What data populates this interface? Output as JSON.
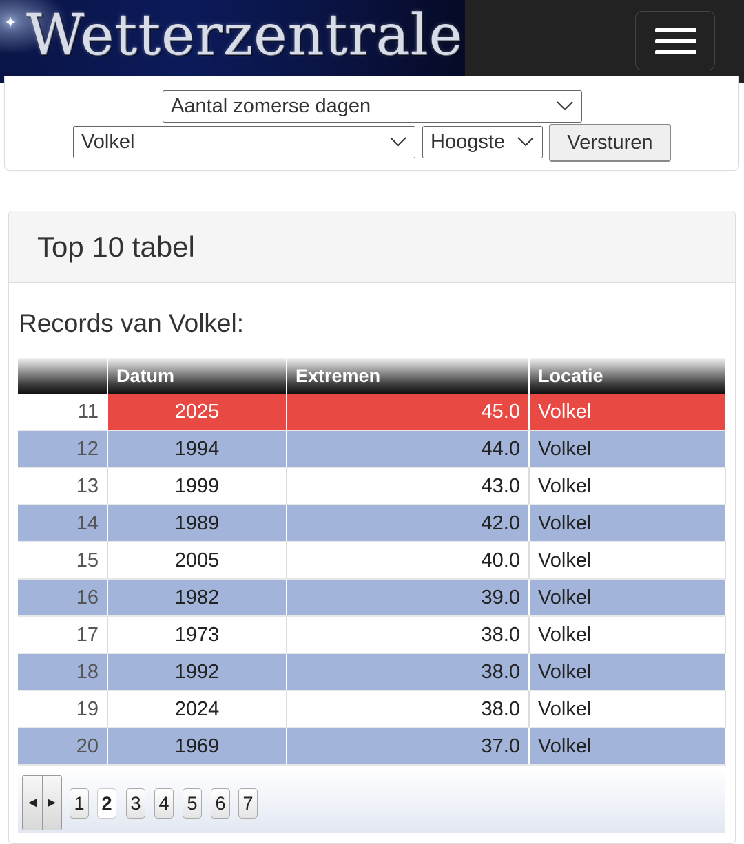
{
  "header": {
    "logo_text": "Wetterzentrale",
    "menu_icon": "hamburger-menu-icon"
  },
  "form": {
    "statistic_select": "Aantal zomerse dagen",
    "station_select": "Volkel",
    "order_select": "Hoogste",
    "submit_label": "Versturen"
  },
  "card": {
    "title": "Top 10 tabel",
    "records_title": "Records van Volkel:"
  },
  "table": {
    "columns": [
      "",
      "Datum",
      "Extremen",
      "Locatie"
    ],
    "rows": [
      {
        "rank": "11",
        "date": "2025",
        "value": "45.0",
        "location": "Volkel"
      },
      {
        "rank": "12",
        "date": "1994",
        "value": "44.0",
        "location": "Volkel"
      },
      {
        "rank": "13",
        "date": "1999",
        "value": "43.0",
        "location": "Volkel"
      },
      {
        "rank": "14",
        "date": "1989",
        "value": "42.0",
        "location": "Volkel"
      },
      {
        "rank": "15",
        "date": "2005",
        "value": "40.0",
        "location": "Volkel"
      },
      {
        "rank": "16",
        "date": "1982",
        "value": "39.0",
        "location": "Volkel"
      },
      {
        "rank": "17",
        "date": "1973",
        "value": "38.0",
        "location": "Volkel"
      },
      {
        "rank": "18",
        "date": "1992",
        "value": "38.0",
        "location": "Volkel"
      },
      {
        "rank": "19",
        "date": "2024",
        "value": "38.0",
        "location": "Volkel"
      },
      {
        "rank": "20",
        "date": "1969",
        "value": "37.0",
        "location": "Volkel"
      }
    ],
    "highlight_color": "#e84a43",
    "alt_row_color": "#a2b4d9"
  },
  "pager": {
    "prev_symbol": "◄",
    "next_symbol": "►",
    "pages": [
      "1",
      "2",
      "3",
      "4",
      "5",
      "6",
      "7"
    ],
    "current_page": "2"
  }
}
